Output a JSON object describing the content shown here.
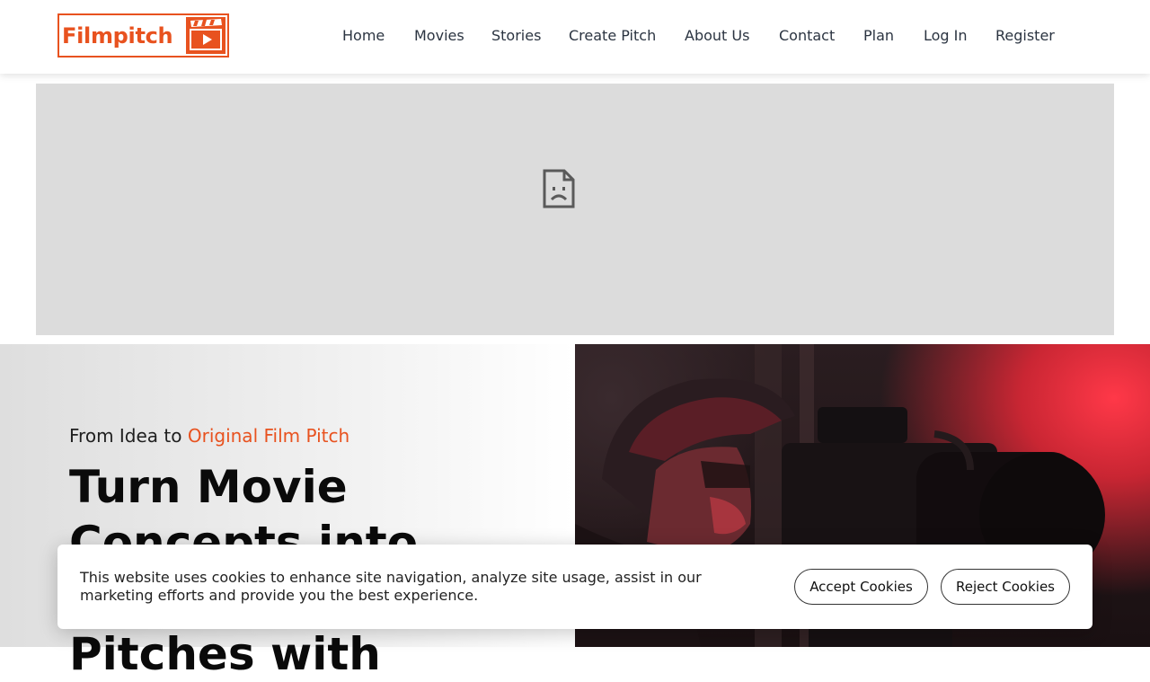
{
  "brand": {
    "name": "Filmpitch",
    "color": "#e8521f",
    "logo_icon": "clapperboard-play-icon"
  },
  "nav": {
    "items": [
      {
        "label": "Home"
      },
      {
        "label": "Movies"
      },
      {
        "label": "Stories"
      },
      {
        "label": "Create Pitch"
      },
      {
        "label": "About Us"
      },
      {
        "label": "Contact"
      },
      {
        "label": "Plan"
      },
      {
        "label": "Log In"
      },
      {
        "label": "Register"
      }
    ]
  },
  "banner": {
    "icon": "broken-image-icon"
  },
  "hero": {
    "tagline_prefix": "From Idea to ",
    "tagline_accent": "Original Film Pitch",
    "headline": "Turn Movie Concepts into Professional Pitches with"
  },
  "cookie_banner": {
    "message": "This website uses cookies to enhance site navigation, analyze site usage, assist in our marketing efforts and provide you the best experience.",
    "accept_label": "Accept Cookies",
    "reject_label": "Reject Cookies"
  }
}
